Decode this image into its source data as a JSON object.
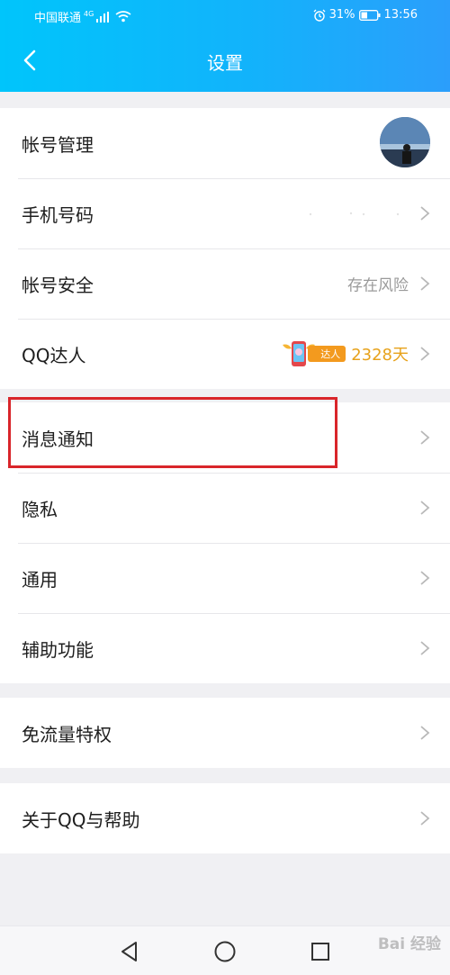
{
  "status_bar": {
    "carrier": "中国联通",
    "network": "4G",
    "battery": "31%",
    "time": "13:56"
  },
  "nav": {
    "title": "设置"
  },
  "account_group": {
    "account": {
      "label": "帐号管理"
    },
    "phone": {
      "label": "手机号码"
    },
    "security": {
      "label": "帐号安全",
      "value": "存在风险"
    },
    "qq_expert": {
      "label": "QQ达人",
      "badge": "达人",
      "days": "2328天"
    }
  },
  "settings_group": {
    "notifications": {
      "label": "消息通知"
    },
    "privacy": {
      "label": "隐私"
    },
    "general": {
      "label": "通用"
    },
    "accessibility": {
      "label": "辅助功能"
    }
  },
  "free_data": {
    "label": "免流量特权"
  },
  "about": {
    "label": "关于QQ与帮助"
  },
  "watermark": "Bai 经验",
  "colors": {
    "header_start": "#00c5fb",
    "header_end": "#2b9efb",
    "highlight": "#d9252a",
    "badge_orange": "#f39a1e"
  }
}
